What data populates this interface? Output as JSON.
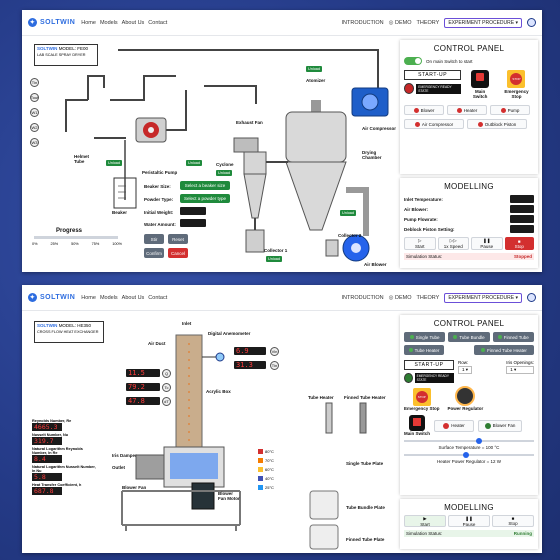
{
  "nav": {
    "brand": "SOLTWIN",
    "links": [
      "Home",
      "Models",
      "About Us",
      "Contact"
    ],
    "right": [
      "INTRODUCTION",
      "DEMO",
      "THEORY"
    ],
    "experiment": "EXPERIMENT PROCEDURE"
  },
  "spray": {
    "model_brand": "SOLTWIN",
    "model": "MODEL: FE00",
    "subtitle": "LAB SCALE SPRAY DRYER",
    "side_indicators": [
      "Tin",
      "Tout",
      "W1",
      "W2",
      "W3"
    ],
    "labels": {
      "helmet_tube": "Helmet Tube",
      "beaker": "Beaker",
      "peristaltic_pump": "Peristaltic Pump",
      "exhaust_fan": "Exhaust Fan",
      "cyclone": "Cyclone",
      "atomizer": "Atomizer",
      "air_compressor": "Air Compressor",
      "drying_chamber": "Drying Chamber",
      "collector1": "Collector 1",
      "collector2": "Collector 2",
      "air_blower": "Air Blower"
    },
    "tag_unload": "Unload",
    "form": {
      "beaker_size": "Beaker Size:",
      "beaker_btn": "Select a beaker size",
      "powder_type": "Powder Type:",
      "powder_btn": "Select a powder type",
      "initial_weight": "Initial Weight:",
      "water_amount": "Water Amount:"
    },
    "progress": {
      "label": "Progress",
      "ticks": [
        "0%",
        "25%",
        "50%",
        "75%",
        "100%"
      ],
      "value": 0.0
    },
    "buttons": {
      "stir": "Stir",
      "reset": "Reset",
      "confirm": "Confirm",
      "cancel": "Cancel"
    },
    "control": {
      "title": "CONTROL PANEL",
      "on_main": "On main Switch to start",
      "start_up": "START-UP",
      "emergency_ready": "EMERGENCY READY STATE",
      "main_switch": "Main Switch",
      "emergency_stop": "Emergency Stop",
      "stop_label": "STOP",
      "toggles": [
        "Blower",
        "Heater",
        "Pump"
      ],
      "air_compressor": "Air Compressor",
      "outblock_piston": "Outblock Piston"
    },
    "modelling": {
      "title": "MODELLING",
      "rows": [
        "Inlet Temperature:",
        "Air Blower:",
        "Pump Flowrate:",
        "Deblock Piston Setting:"
      ],
      "actions": [
        "Start",
        "1x Speed",
        "Pause",
        "Stop"
      ],
      "status_label": "Simulation Status:",
      "status_value": "Stopped"
    }
  },
  "heat": {
    "model_brand": "SOLTWIN",
    "model": "MODEL: HE350",
    "subtitle": "CROSS FLOW HEAT EXCHANGER",
    "labels": {
      "inlet": "Inlet",
      "air_duct": "Air Duct",
      "digital_anemometer": "Digital Anemometer",
      "acrylic_box": "Acrylic Box",
      "iris_damper": "Iris Damper",
      "outlet": "Outlet",
      "blower_fan": "Blower Fan",
      "blower_fan_motor": "Blower Fan Motor",
      "tube_heater": "Tube Heater",
      "finned_tube_heater": "Finned Tube Heater",
      "single_tube_plate": "Single Tube Plate",
      "tube_bundle_plate": "Tube Bundle Plate",
      "finned_tube_plate": "Finned Tube Plate"
    },
    "readings": {
      "vin": "6.9",
      "tin": "31.3",
      "q": "11.5",
      "tc": "79.2",
      "dt": "47.8",
      "vin_label": "Vin",
      "tin_label": "Tin",
      "q_label": "Q",
      "tc_label": "Tc",
      "dt_label": "dT"
    },
    "results": [
      {
        "label": "Reynolds Number, Re",
        "value": "4665.3"
      },
      {
        "label": "Nusselt Number, Nu",
        "value": "319.7"
      },
      {
        "label": "Natural Logarithm Reynolds Number, ln Re",
        "value": "8.4"
      },
      {
        "label": "Natural Logarithm Nusselt Number, ln Nu",
        "value": "5.8"
      },
      {
        "label": "Heat Transfer Coefficient, h",
        "value": "687.8"
      }
    ],
    "legend": [
      "80°C",
      "70°C",
      "60°C",
      "40°C",
      "25°C"
    ],
    "legend_colors": [
      "#d32f2f",
      "#f57c00",
      "#fbc02d",
      "#3f51b5",
      "#2196f3"
    ],
    "control": {
      "title": "CONTROL PANEL",
      "buttons": [
        "Single Tube",
        "Tube Bundle",
        "Finned Tube",
        "Tube Heater",
        "Finned Tube Heater"
      ],
      "start_up": "START-UP",
      "emergency_ready": "EMERGENCY READY STATE",
      "emergency_stop": "Emergency Stop",
      "power_regulator": "Power Regulator",
      "row_label": "Row:",
      "iris_label": "Iris Openings:",
      "row_value": "1",
      "iris_value": "1",
      "main_switch": "Main Switch",
      "heater": "Heater",
      "blower_fan": "Blower Fan",
      "surface_temp": "Surface Temperature = 100 °C",
      "heater_power": "Heater Power Regulator = 12 W",
      "stop_label": "STOP"
    },
    "modelling": {
      "title": "MODELLING",
      "actions": [
        "Start",
        "Pause",
        "Stop"
      ],
      "status_label": "Simulation Status:",
      "status_value": "Running"
    }
  }
}
